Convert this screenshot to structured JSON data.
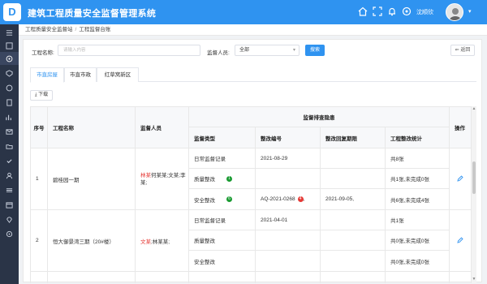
{
  "app": {
    "title": "建筑工程质量安全监督管理系统",
    "user_name": "沈顺欣"
  },
  "colors": {
    "primary": "#2f93f0",
    "sidebar": "#2a3447",
    "danger": "#e53935",
    "success": "#1a9b32"
  },
  "breadcrumb": [
    "工程质量安全监督站",
    "工程监督台账"
  ],
  "filters": {
    "project_label": "工程名称:",
    "project_placeholder": "请输入内容",
    "supervisor_label": "监督人员:",
    "supervisor_value": "全部",
    "search_label": "搜索",
    "back_label": "返回"
  },
  "tabs": [
    "市直房屋",
    "市直市政",
    "红草窝新区"
  ],
  "download_label": "下载",
  "table": {
    "headers": {
      "index": "序号",
      "project": "工程名称",
      "supervisors": "监督人员",
      "group": "监督排查隐患",
      "type": "监督类型",
      "code": "整改编号",
      "deadline": "整改回复期限",
      "stats": "工程整改统计",
      "ops": "操作"
    },
    "rows": [
      {
        "index": "1",
        "project": "碧桂园一期",
        "supervisors_red": "林某",
        "supervisors_rest": "何某某;文某;李某;",
        "sub": [
          {
            "type": "日常监督记录",
            "badge": "",
            "code": "2021-08-29",
            "code_badge": "",
            "deadline": "",
            "stats": "共8张"
          },
          {
            "type": "质量整改",
            "badge": "1",
            "code": "",
            "code_badge": "",
            "deadline": "",
            "stats": "共1张,未完成0张"
          },
          {
            "type": "安全整改",
            "badge": "6",
            "code": "AQ-2021-0268",
            "code_badge": "4",
            "deadline": "2021-09-05,",
            "stats": "共6张,未完成4张"
          }
        ]
      },
      {
        "index": "2",
        "project": "恒大御景湾三期（20#楼）",
        "supervisors_red": "文某",
        "supervisors_rest": ";林某某;",
        "sub": [
          {
            "type": "日常监督记录",
            "badge": "",
            "code": "2021-04-01",
            "code_badge": "",
            "deadline": "",
            "stats": "共1张"
          },
          {
            "type": "质量整改",
            "badge": "",
            "code": "",
            "code_badge": "",
            "deadline": "",
            "stats": "共0张,未完成0张"
          },
          {
            "type": "安全整改",
            "badge": "",
            "code": "",
            "code_badge": "",
            "deadline": "",
            "stats": "共0张,未完成0张"
          }
        ]
      }
    ]
  }
}
